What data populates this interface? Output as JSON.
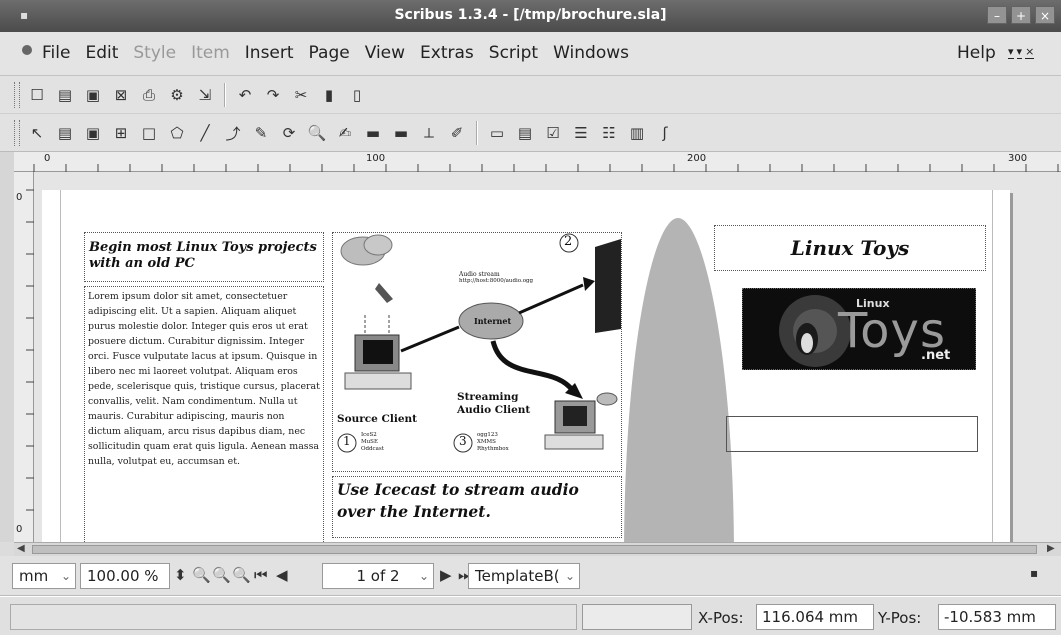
{
  "window": {
    "title": "Scribus 1.3.4 - [/tmp/brochure.sla]"
  },
  "menubar": {
    "items": [
      {
        "label": "File",
        "disabled": false
      },
      {
        "label": "Edit",
        "disabled": false
      },
      {
        "label": "Style",
        "disabled": true
      },
      {
        "label": "Item",
        "disabled": true
      },
      {
        "label": "Insert",
        "disabled": false
      },
      {
        "label": "Page",
        "disabled": false
      },
      {
        "label": "View",
        "disabled": false
      },
      {
        "label": "Extras",
        "disabled": false
      },
      {
        "label": "Script",
        "disabled": false
      },
      {
        "label": "Windows",
        "disabled": false
      }
    ],
    "help": "Help"
  },
  "ruler": {
    "h_labels": [
      "0",
      "100",
      "200",
      "300"
    ],
    "v_labels": [
      "0",
      "0"
    ]
  },
  "document": {
    "heading": "Begin most Linux Toys projects with an old PC",
    "body": "Lorem ipsum dolor sit amet, consectetuer adipiscing elit. Ut a sapien. Aliquam aliquet purus molestie dolor. Integer quis eros ut erat posuere dictum. Curabitur dignissim. Integer orci. Fusce vulputate lacus at ipsum. Quisque in libero nec mi laoreet volutpat. Aliquam eros pede, scelerisque quis, tristique cursus, placerat convallis, velit. Nam condimentum. Nulla ut mauris. Curabitur adipiscing, mauris non dictum aliquam, arcu risus dapibus diam, nec sollicitudin quam erat quis ligula. Aenean massa nulla, volutpat eu, accumsan et.",
    "diagram": {
      "audio_stream": "Audio stream",
      "audio_url": "http://host:8000/audio.ogg",
      "internet": "Internet",
      "source_client": "Source Client",
      "source_apps": [
        "IceS2",
        "MuSE",
        "Oddcast"
      ],
      "streaming_client": "Streaming Audio Client",
      "streaming_apps": [
        "ogg123",
        "XMMS",
        "Rhythmbox"
      ],
      "step1": "1",
      "step2": "2",
      "step3": "3"
    },
    "caption": "Use Icecast to stream audio over the Internet.",
    "right_title": "Linux Toys",
    "logo": {
      "top": "Linux",
      "main": "Toys",
      "bottom": ".net"
    }
  },
  "zoombar": {
    "unit": "mm",
    "zoom": "100.00 %",
    "page": "1 of 2",
    "layer": "TemplateB("
  },
  "status": {
    "xpos_label": "X-Pos:",
    "xpos_value": "116.064 mm",
    "ypos_label": "Y-Pos:",
    "ypos_value": "-10.583 mm"
  }
}
